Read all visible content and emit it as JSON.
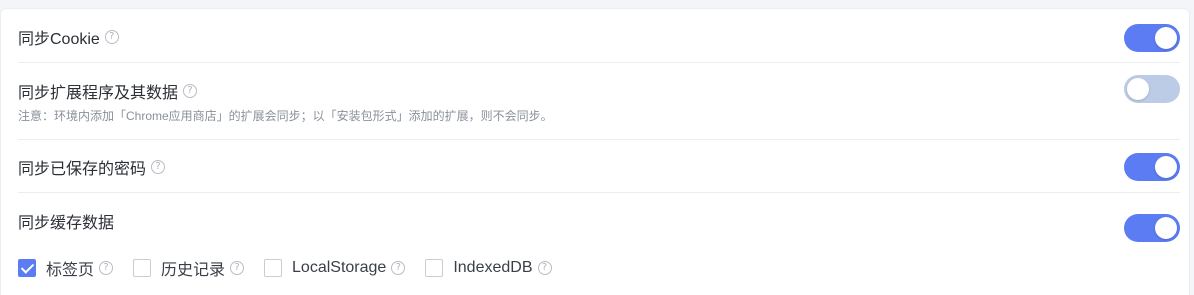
{
  "settings": [
    {
      "label": "同步Cookie",
      "has_help": true,
      "enabled": true
    },
    {
      "label": "同步扩展程序及其数据",
      "has_help": true,
      "enabled": false,
      "note": "注意：环境内添加「Chrome应用商店」的扩展会同步；以「安装包形式」添加的扩展，则不会同步。"
    },
    {
      "label": "同步已保存的密码",
      "has_help": true,
      "enabled": true
    },
    {
      "label": "同步缓存数据",
      "has_help": false,
      "enabled": true
    }
  ],
  "cache_options": [
    {
      "label": "标签页",
      "checked": true
    },
    {
      "label": "历史记录",
      "checked": false
    },
    {
      "label": "LocalStorage",
      "checked": false
    },
    {
      "label": "IndexedDB",
      "checked": false
    }
  ],
  "help_glyph": "?",
  "colors": {
    "accent": "#5b7cf2",
    "toggle_off": "#bccbe6",
    "text": "#2b2f36",
    "note": "#8a909a"
  }
}
